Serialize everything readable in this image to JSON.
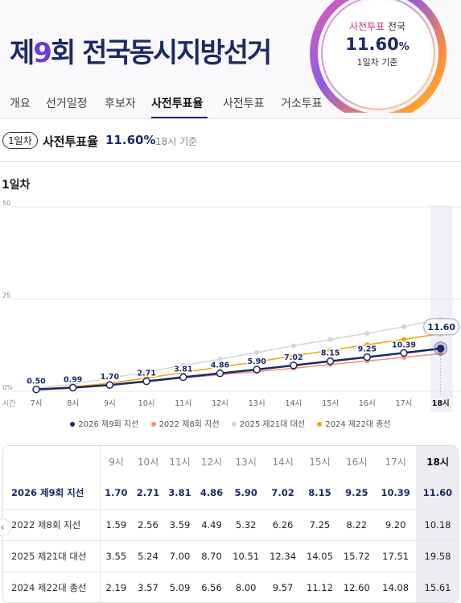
{
  "header": {
    "title_pre": "제",
    "title_num": "9",
    "title_post": "회 전국동시지방선거",
    "badge": {
      "line1_accent": "사전투표",
      "line1_rest": " 전국",
      "value": "11.60",
      "unit": "%",
      "line3": "1일차 기준"
    }
  },
  "tabs": [
    "개요",
    "선거일정",
    "후보자",
    "사전투표율",
    "사전투표",
    "거소투표"
  ],
  "active_tab": "사전투표율",
  "summary": {
    "pill": "1일차",
    "label": "사전투표율",
    "value": "11.60%",
    "base": "18시 기준"
  },
  "section_title": "1일차",
  "colors": {
    "primary": "#1d2a63",
    "s2022": "#f0917a",
    "s2025": "#d5d5d8",
    "s2024": "#f0a20a"
  },
  "chart_data": {
    "type": "line",
    "x_axis_label": "시간",
    "x": [
      "7시",
      "8시",
      "9시",
      "10시",
      "11시",
      "12시",
      "13시",
      "14시",
      "15시",
      "16시",
      "17시",
      "18시"
    ],
    "ylim": [
      0,
      50
    ],
    "yticks": [
      "0%",
      "25",
      "50"
    ],
    "series": [
      {
        "name": "2026 제9회 지선",
        "values": [
          0.5,
          0.99,
          1.7,
          2.71,
          3.81,
          4.86,
          5.9,
          7.02,
          8.15,
          9.25,
          10.39,
          11.6
        ],
        "labels": [
          "0.50",
          "0.99",
          "1.70",
          "2.71",
          "3.81",
          "4.86",
          "5.90",
          "7.02",
          "8.15",
          "9.25",
          "10.39",
          "11.60"
        ]
      },
      {
        "name": "2022 제8회 지선",
        "values": [
          0.45,
          0.9,
          1.59,
          2.56,
          3.59,
          4.49,
          5.32,
          6.26,
          7.25,
          8.22,
          9.2,
          10.18
        ]
      },
      {
        "name": "2025 제21대 대선",
        "values": [
          0.9,
          1.9,
          3.55,
          5.24,
          7.0,
          8.7,
          10.51,
          12.34,
          14.05,
          15.72,
          17.51,
          19.58
        ]
      },
      {
        "name": "2024 제22대 총선",
        "values": [
          0.6,
          1.2,
          2.19,
          3.57,
          5.09,
          6.56,
          8.0,
          9.57,
          11.12,
          12.6,
          14.08,
          15.61
        ]
      }
    ],
    "highlight_index": 11
  },
  "table": {
    "columns": [
      "9시",
      "10시",
      "11시",
      "12시",
      "13시",
      "14시",
      "15시",
      "16시",
      "17시",
      "18시"
    ],
    "rows": [
      {
        "label": "2026 제9회 지선",
        "values": [
          "1.70",
          "2.71",
          "3.81",
          "4.86",
          "5.90",
          "7.02",
          "8.15",
          "9.25",
          "10.39",
          "11.60"
        ]
      },
      {
        "label": "2022 제8회 지선",
        "values": [
          "1.59",
          "2.56",
          "3.59",
          "4.49",
          "5.32",
          "6.26",
          "7.25",
          "8.22",
          "9.20",
          "10.18"
        ]
      },
      {
        "label": "2025 제21대 대선",
        "values": [
          "3.55",
          "5.24",
          "7.00",
          "8.70",
          "10.51",
          "12.34",
          "14.05",
          "15.72",
          "17.51",
          "19.58"
        ]
      },
      {
        "label": "2024 제22대 총선",
        "values": [
          "2.19",
          "3.57",
          "5.09",
          "6.56",
          "8.00",
          "9.57",
          "11.12",
          "12.60",
          "14.08",
          "15.61"
        ]
      }
    ]
  }
}
